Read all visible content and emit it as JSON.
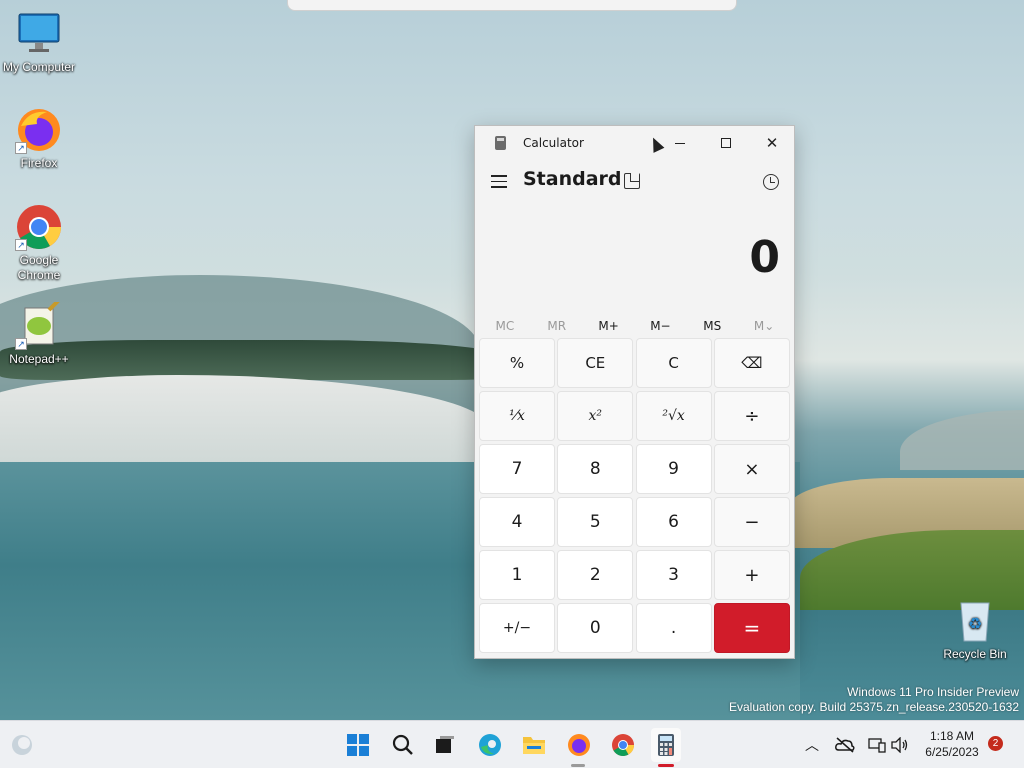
{
  "desktop": {
    "icons": [
      {
        "label": "My Computer"
      },
      {
        "label": "Firefox"
      },
      {
        "label": "Google Chrome"
      },
      {
        "label": "Notepad++"
      },
      {
        "label": "Recycle Bin"
      }
    ],
    "watermark": {
      "line1": "Windows 11 Pro Insider Preview",
      "line2": "Evaluation copy. Build 25375.zn_release.230520-1632"
    }
  },
  "calculator": {
    "title": "Calculator",
    "mode": "Standard",
    "display": "0",
    "memory": [
      {
        "label": "MC",
        "enabled": false
      },
      {
        "label": "MR",
        "enabled": false
      },
      {
        "label": "M+",
        "enabled": true
      },
      {
        "label": "M−",
        "enabled": true
      },
      {
        "label": "MS",
        "enabled": true
      },
      {
        "label": "M⌄",
        "enabled": false
      }
    ],
    "keys": {
      "percent": "%",
      "ce": "CE",
      "c": "C",
      "backspace": "⌫",
      "reciprocal": "⅟x",
      "square": "x²",
      "sqrt": "²√x",
      "divide": "÷",
      "seven": "7",
      "eight": "8",
      "nine": "9",
      "multiply": "×",
      "four": "4",
      "five": "5",
      "six": "6",
      "minus": "−",
      "one": "1",
      "two": "2",
      "three": "3",
      "plus": "+",
      "negate": "+/−",
      "zero": "0",
      "decimal": ".",
      "equals": "="
    },
    "accent": "#d11c2a"
  },
  "taskbar": {
    "apps": [
      "start",
      "search",
      "task-view",
      "edge",
      "file-explorer",
      "firefox",
      "chrome",
      "calculator"
    ],
    "time": "1:18 AM",
    "date": "6/25/2023",
    "notifications": "2"
  }
}
